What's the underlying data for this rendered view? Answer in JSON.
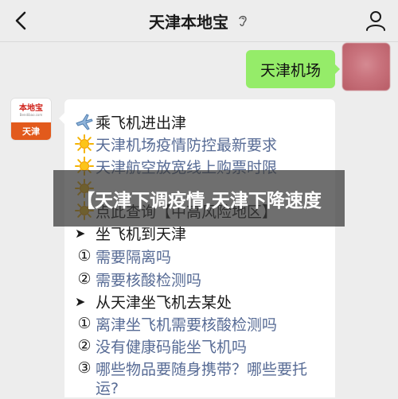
{
  "header": {
    "title": "天津本地宝"
  },
  "chat": {
    "outgoing": {
      "text": "天津机场"
    },
    "account": {
      "logo_text": "本地宝",
      "logo_sub": "Bendibao.com",
      "city": "天津"
    },
    "lines": [
      {
        "lead": "plane-icon",
        "text": "乘飞机进出津",
        "type": "heading"
      },
      {
        "lead": "sun-icon",
        "text": "天津机场疫情防控最新要求",
        "type": "link"
      },
      {
        "lead": "sun-icon",
        "text": "天津航空放宽线上购票时限",
        "type": "link"
      },
      {
        "lead": "sun-icon",
        "text": "",
        "type": "link"
      },
      {
        "lead": "sun-icon",
        "text": "点此查询【中高风险地区】",
        "type": "plain"
      },
      {
        "lead": "➤",
        "text": "坐飞机到天津",
        "type": "heading"
      },
      {
        "lead": "①",
        "text": "需要隔离吗",
        "type": "link"
      },
      {
        "lead": "②",
        "text": "需要核酸检测吗",
        "type": "link"
      },
      {
        "lead": "➤",
        "text": "从天津坐飞机去某处",
        "type": "heading"
      },
      {
        "lead": "①",
        "text": "离津坐飞机需要核酸检测吗",
        "type": "link"
      },
      {
        "lead": "②",
        "text": "没有健康码能坐飞机吗",
        "type": "link"
      },
      {
        "lead": "③",
        "text": "哪些物品要随身携带？哪些要托",
        "type": "link"
      },
      {
        "lead": "",
        "text": "运?",
        "type": "link"
      }
    ]
  },
  "banner": {
    "text": "【天津下调疫情,天津下降速度"
  },
  "colors": {
    "link": "#576b95",
    "outgoing_bubble": "#95ec69",
    "banner_bg": "#373737",
    "account_city_bg": "#e25a1c"
  }
}
